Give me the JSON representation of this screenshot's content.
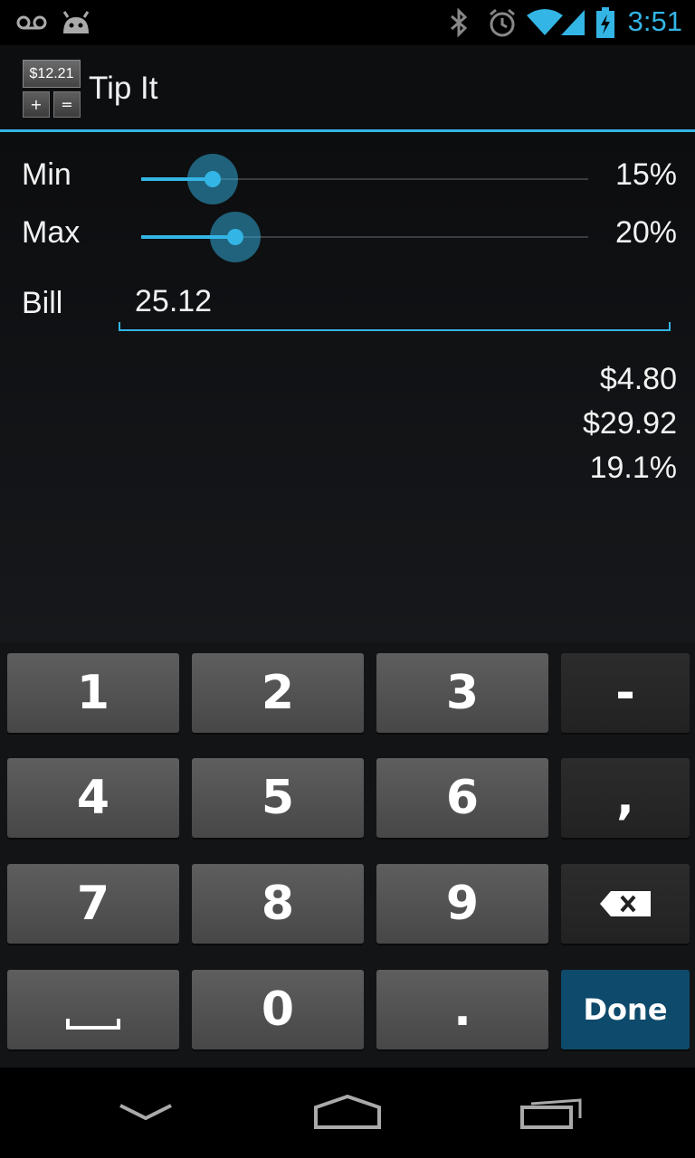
{
  "status_bar": {
    "time": "3:51",
    "icons": [
      "voicemail-icon",
      "android-icon",
      "bluetooth-icon",
      "alarm-icon",
      "wifi-icon",
      "signal-icon",
      "battery-charging-icon"
    ],
    "accent": "#33b5e5"
  },
  "action_bar": {
    "icon_price": "$12.21",
    "icon_plus": "+",
    "icon_equals": "=",
    "title": "Tip It"
  },
  "form": {
    "min_label": "Min",
    "min_value": "15%",
    "min_fraction": 0.16,
    "max_label": "Max",
    "max_value": "20%",
    "max_fraction": 0.21,
    "bill_label": "Bill",
    "bill_value": "25.12"
  },
  "results": {
    "tip": "$4.80",
    "total": "$29.92",
    "percent": "19.1%"
  },
  "keyboard": {
    "rows": [
      [
        "1",
        "2",
        "3",
        "-"
      ],
      [
        "4",
        "5",
        "6",
        ","
      ],
      [
        "7",
        "8",
        "9",
        "backspace"
      ],
      [
        "space",
        "0",
        ".",
        "Done"
      ]
    ],
    "done_label": "Done",
    "done_color": "#0e4a6b"
  },
  "nav_bar": {
    "icons": [
      "back-icon",
      "home-icon",
      "recent-apps-icon"
    ]
  }
}
